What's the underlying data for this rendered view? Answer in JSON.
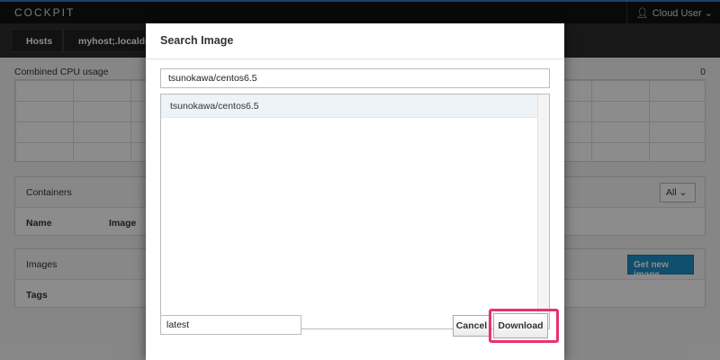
{
  "topbar": {
    "brand": "COCKPIT",
    "user_label": "Cloud User",
    "user_icon": "user-icon",
    "user_caret": "⌄"
  },
  "subnav": {
    "tabs": [
      {
        "label": "Hosts"
      },
      {
        "label": "myhost;.localdoma"
      }
    ]
  },
  "dashboard": {
    "cpu_title": "Combined CPU usage",
    "cpu_value": "0",
    "containers": {
      "title": "Containers",
      "filter_label": "All",
      "filter_caret": "⌄",
      "columns": [
        "Name",
        "Image"
      ]
    },
    "images": {
      "title": "Images",
      "get_new_label": "Get new image",
      "columns": [
        "Tags"
      ]
    }
  },
  "modal": {
    "title": "Search Image",
    "search_value": "tsunokawa/centos6.5",
    "results": [
      "tsunokawa/centos6.5"
    ],
    "tag_value": "latest",
    "cancel_label": "Cancel",
    "download_label": "Download",
    "highlight_color": "#e8336d"
  }
}
